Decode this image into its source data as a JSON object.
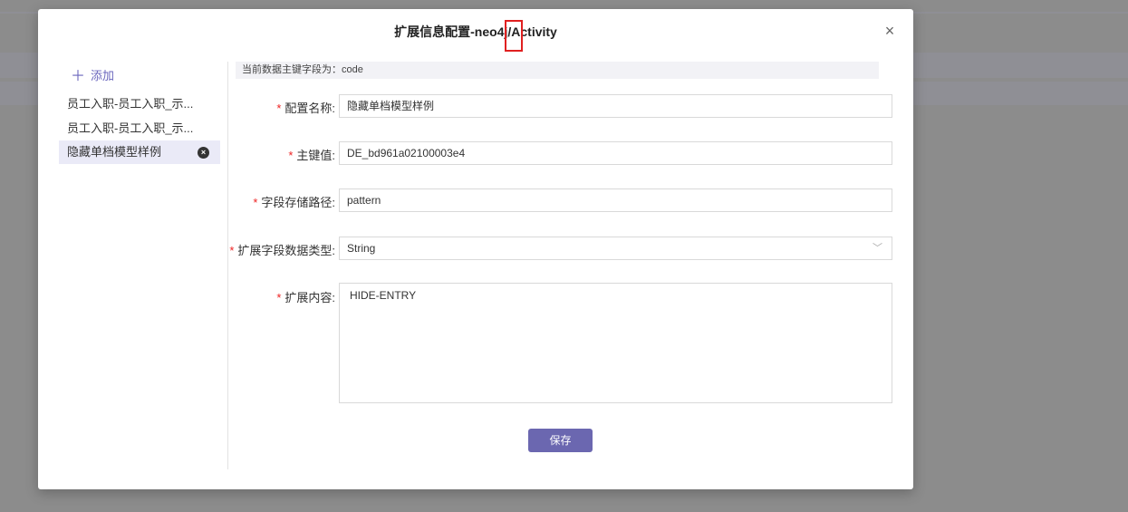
{
  "dialog": {
    "title": "扩展信息配置-neo4j/Activity",
    "close_label": "×"
  },
  "sidebar": {
    "add_label": "添加",
    "add_icon": "＋",
    "items": [
      {
        "label": "员工入职-员工入职_示..."
      },
      {
        "label": "员工入职-员工入职_示..."
      },
      {
        "label": "隐藏单档模型样例",
        "selected": true,
        "remove_icon": "×"
      }
    ]
  },
  "form": {
    "notice": "当前数据主键字段为：code",
    "config_name": {
      "label": "配置名称:",
      "value": "隐藏单档模型样例"
    },
    "primary_key": {
      "label": "主键值:",
      "value": "DE_bd961a02100003e4"
    },
    "storage_path": {
      "label": "字段存储路径:",
      "value": "pattern"
    },
    "data_type": {
      "label": "扩展字段数据类型:",
      "value": "String"
    },
    "content": {
      "label": "扩展内容:",
      "value": "HIDE-ENTRY"
    },
    "required_mark": "*",
    "save_label": "保存"
  },
  "colors": {
    "accent": "#6b67b0",
    "required": "#e22222",
    "highlight": "#e02020"
  }
}
